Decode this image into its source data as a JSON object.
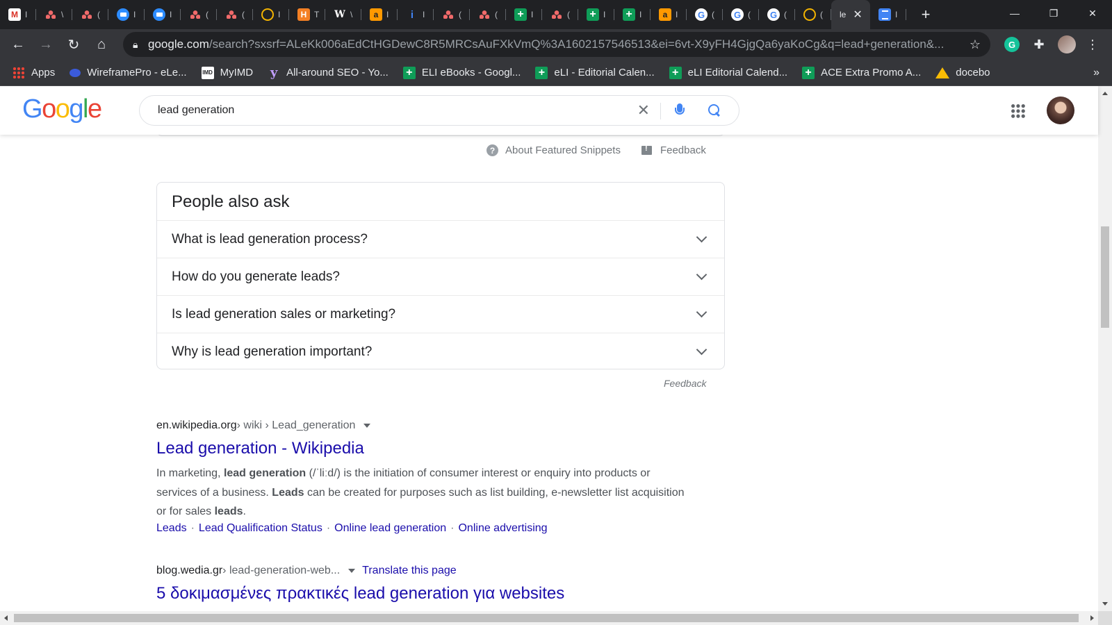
{
  "browser": {
    "tabs": [
      {
        "icon": "gmail-icon",
        "glyph": "M"
      },
      {
        "icon": "asana-icon"
      },
      {
        "icon": "asana-icon"
      },
      {
        "icon": "zoom-icon"
      },
      {
        "icon": "zoom-icon"
      },
      {
        "icon": "asana-icon"
      },
      {
        "icon": "asana-icon"
      },
      {
        "icon": "ring-icon"
      },
      {
        "icon": "h-icon",
        "glyph": "H"
      },
      {
        "icon": "wikipedia-icon",
        "glyph": "W"
      },
      {
        "icon": "amazon-icon",
        "glyph": "a"
      },
      {
        "icon": "info-icon",
        "glyph": "i"
      },
      {
        "icon": "asana-icon"
      },
      {
        "icon": "asana-icon"
      },
      {
        "icon": "sheets-icon"
      },
      {
        "icon": "asana-icon"
      },
      {
        "icon": "sheets-icon"
      },
      {
        "icon": "sheets-icon"
      },
      {
        "icon": "amazon-icon",
        "glyph": "a"
      },
      {
        "icon": "google-icon",
        "glyph": "G"
      },
      {
        "icon": "google-icon",
        "glyph": "G"
      },
      {
        "icon": "google-icon",
        "glyph": "G"
      },
      {
        "icon": "ring-icon"
      }
    ],
    "active_tab": {
      "title": "le"
    },
    "url_host": "google.com",
    "url_path": "/search?sxsrf=ALeKk006aEdCtHGDewC8R5MRCsAuFXkVmQ%3A1602157546513&ei=6vt-X9yFH4GjgQa6yaKoCg&q=lead+generation&...",
    "bookmarks": [
      {
        "label": "Apps",
        "icon": "apps-grid-icon"
      },
      {
        "label": "WireframePro - eLe...",
        "icon": "wireframepro-icon"
      },
      {
        "label": "MyIMD",
        "icon": "imd-icon",
        "glyph": "IMD"
      },
      {
        "label": "All-around SEO - Yo...",
        "icon": "yoast-icon",
        "glyph": "y"
      },
      {
        "label": "ELI eBooks - Googl...",
        "icon": "sheets-icon",
        "glyph": "+"
      },
      {
        "label": "eLI - Editorial Calen...",
        "icon": "sheets-icon",
        "glyph": "+"
      },
      {
        "label": "eLI Editorial Calend...",
        "icon": "sheets-icon",
        "glyph": "+"
      },
      {
        "label": "ACE Extra Promo A...",
        "icon": "sheets-icon",
        "glyph": "+"
      },
      {
        "label": "docebo",
        "icon": "drive-icon"
      }
    ],
    "bookmarks_more": "»",
    "extension_glyph": "G"
  },
  "google": {
    "logo": [
      "G",
      "o",
      "o",
      "g",
      "l",
      "e"
    ],
    "query": "lead generation",
    "snippet_links": {
      "about": "About Featured Snippets",
      "feedback": "Feedback"
    },
    "paa": {
      "title": "People also ask",
      "questions": [
        "What is lead generation process?",
        "How do you generate leads?",
        "Is lead generation sales or marketing?",
        "Why is lead generation important?"
      ],
      "feedback": "Feedback"
    },
    "results": [
      {
        "domain": "en.wikipedia.org",
        "path": " › wiki › Lead_generation",
        "title": "Lead generation - Wikipedia",
        "desc_1": "In marketing, ",
        "desc_b1": "lead generation",
        "desc_2": " (/ˈliːd/) is the initiation of consumer interest or enquiry into products or services of a business. ",
        "desc_b2": "Leads",
        "desc_3": " can be created for purposes such as list building, e-newsletter list acquisition or for sales ",
        "desc_b3": "leads",
        "desc_4": ".",
        "sitelinks": [
          "Leads",
          "Lead Qualification Status",
          "Online lead generation",
          "Online advertising"
        ]
      },
      {
        "domain": "blog.wedia.gr",
        "path": " › lead-generation-web...",
        "translate": "Translate this page",
        "title": "5 δοκιμασμένες πρακτικές lead generation για websites"
      }
    ]
  }
}
